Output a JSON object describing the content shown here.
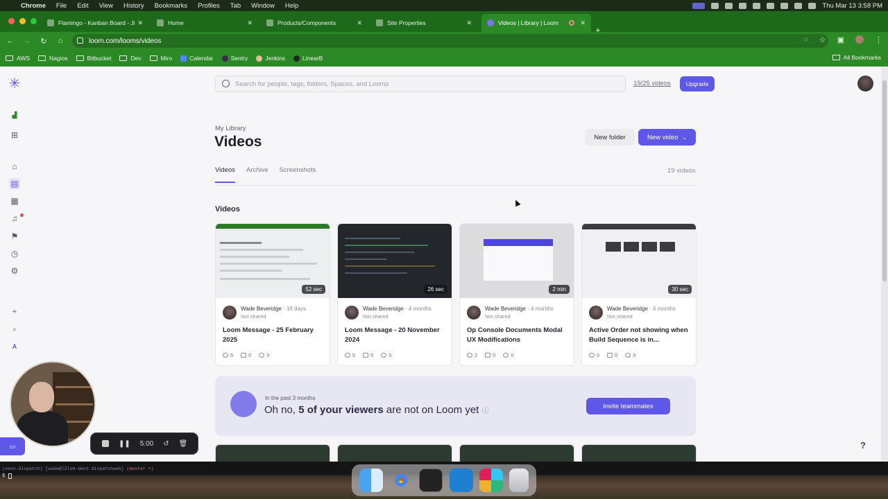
{
  "menubar": {
    "app": "Chrome",
    "items": [
      "File",
      "Edit",
      "View",
      "History",
      "Bookmarks",
      "Profiles",
      "Tab",
      "Window",
      "Help"
    ],
    "clock": "Thu Mar 13  3:58 PM"
  },
  "tabs": [
    {
      "label": "Flamingo - Kanban Board - Ji"
    },
    {
      "label": "Home"
    },
    {
      "label": "Products/Components"
    },
    {
      "label": "Site Properties"
    },
    {
      "label": "Videos | Library | Loom"
    }
  ],
  "toolbar": {
    "url": "loom.com/looms/videos"
  },
  "bookmarks": {
    "items": [
      "AWS",
      "Nagios",
      "Bitbucket",
      "Dev",
      "Miro",
      "Calendar",
      "Sentry",
      "Jenkins",
      "LinearB"
    ],
    "all": "All Bookmarks"
  },
  "search": {
    "placeholder": "Search for people, tags, folders, Spaces, and Looms"
  },
  "quota": {
    "count": "19/25 videos",
    "upgrade": "Upgrade"
  },
  "header": {
    "breadcrumb": "My Library",
    "title": "Videos",
    "new_folder": "New folder",
    "new_video": "New video"
  },
  "lib_tabs": {
    "items": [
      "Videos",
      "Archive",
      "Screenshots"
    ],
    "count": "19 videos"
  },
  "section_title": "Videos",
  "videos": [
    {
      "duration": "52 sec",
      "author": "Wade Beveridge",
      "ago": "· 16 days",
      "share": "Not shared",
      "title": "Loom Message - 25 February 2025",
      "views": "6",
      "comments": "0",
      "reactions": "0"
    },
    {
      "duration": "26 sec",
      "author": "Wade Beveridge",
      "ago": "· 4 months",
      "share": "Not shared",
      "title": "Loom Message - 20 November 2024",
      "views": "5",
      "comments": "0",
      "reactions": "0"
    },
    {
      "duration": "2 min",
      "author": "Wade Beveridge",
      "ago": "· 4 months",
      "share": "Not shared",
      "title": "Op Console Documents Modal UX Modifications",
      "views": "2",
      "comments": "0",
      "reactions": "0"
    },
    {
      "duration": "30 sec",
      "author": "Wade Beveridge",
      "ago": "· 4 months",
      "share": "Not shared",
      "title": "Active Order not showing when Build Sequence is in...",
      "views": "0",
      "comments": "0",
      "reactions": "0"
    }
  ],
  "banner": {
    "small": "In the past 3 months",
    "lead": "Oh no, ",
    "bold": "5 of your viewers",
    "tail": " are not on Loom yet",
    "invite": "Invite teammates"
  },
  "recorder": {
    "time": "5:00"
  },
  "terminal": {
    "line1_a": "(venv-dispatch) [wade@l2lvm-dev1 dispatchweb] ",
    "line1_b": "(master +)",
    "prompt": "$"
  },
  "help": "?",
  "colors": {
    "accent": "#5f57e8",
    "chrome_green": "#2b8a26"
  }
}
